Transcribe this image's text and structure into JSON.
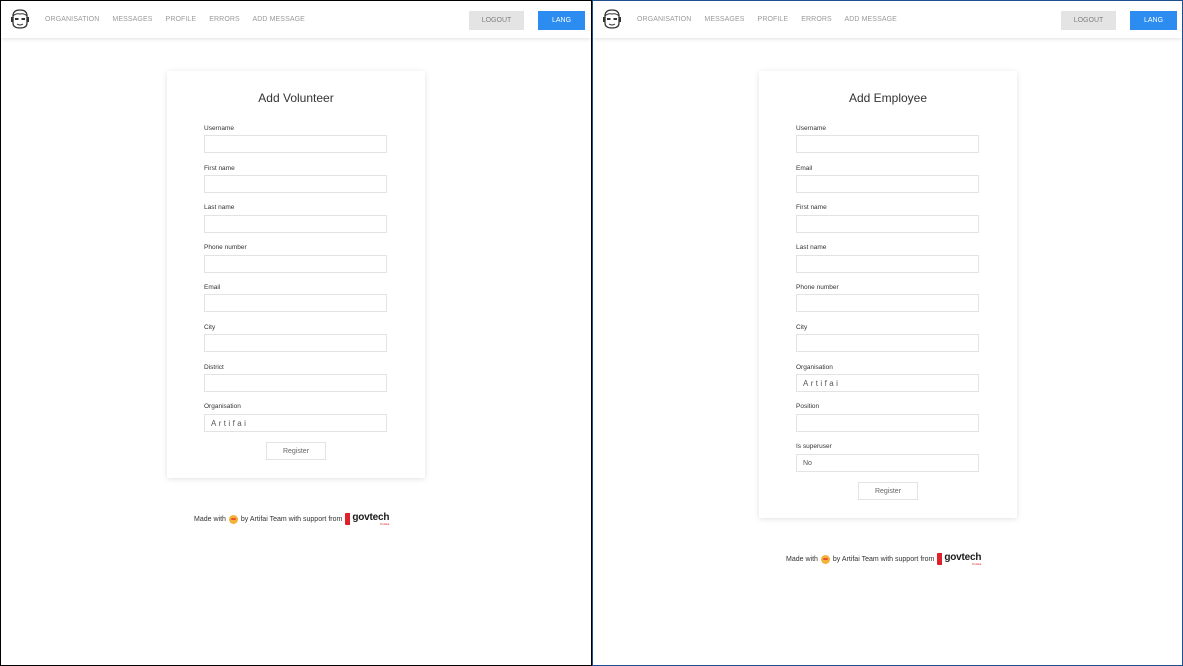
{
  "nav": {
    "items": [
      "ORGANISATION",
      "MESSAGES",
      "PROFILE",
      "ERRORS",
      "ADD MESSAGE"
    ],
    "logout_label": "LOGOUT",
    "lang_label": "LANG"
  },
  "volunteer_form": {
    "title": "Add Volunteer",
    "fields": [
      {
        "label": "Username",
        "value": ""
      },
      {
        "label": "First name",
        "value": ""
      },
      {
        "label": "Last name",
        "value": ""
      },
      {
        "label": "Phone number",
        "value": ""
      },
      {
        "label": "Email",
        "value": ""
      },
      {
        "label": "City",
        "value": ""
      },
      {
        "label": "District",
        "value": ""
      },
      {
        "label": "Organisation",
        "value": "Artifai"
      }
    ],
    "submit_label": "Register"
  },
  "employee_form": {
    "title": "Add Employee",
    "fields": [
      {
        "label": "Username",
        "value": ""
      },
      {
        "label": "Email",
        "value": ""
      },
      {
        "label": "First name",
        "value": ""
      },
      {
        "label": "Last name",
        "value": ""
      },
      {
        "label": "Phone number",
        "value": ""
      },
      {
        "label": "City",
        "value": ""
      },
      {
        "label": "Organisation",
        "value": "Artifai"
      },
      {
        "label": "Position",
        "value": ""
      },
      {
        "label": "Is superuser",
        "value": "No"
      }
    ],
    "submit_label": "Register"
  },
  "footer": {
    "made_with": "Made with",
    "emoji_icon": "grinning-face-emoji",
    "by_text": "by Artifai Team with support from",
    "brand": "govtech",
    "brand_sub": "Polska"
  },
  "colors": {
    "accent": "#2d8cf0",
    "brand_red": "#e0202a"
  }
}
